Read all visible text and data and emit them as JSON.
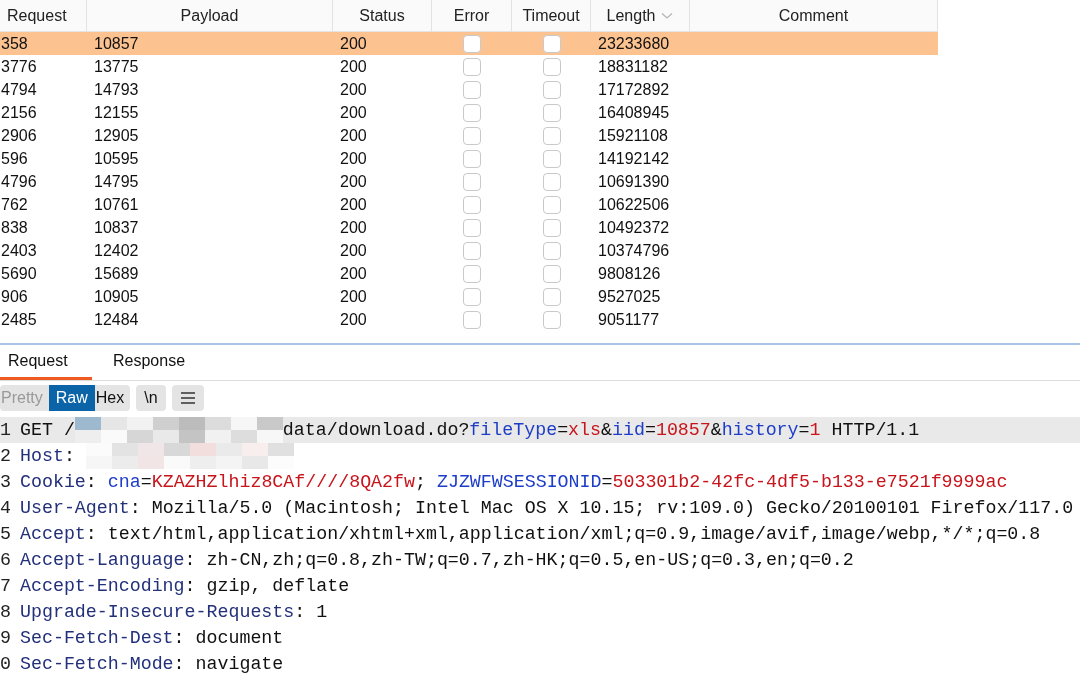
{
  "table": {
    "columns": [
      {
        "label": "Request",
        "sorted": false
      },
      {
        "label": "Payload",
        "sorted": false
      },
      {
        "label": "Status",
        "sorted": false
      },
      {
        "label": "Error",
        "sorted": false
      },
      {
        "label": "Timeout",
        "sorted": false
      },
      {
        "label": "Length",
        "sorted": true
      },
      {
        "label": "Comment",
        "sorted": false
      }
    ],
    "rows": [
      {
        "request": "358",
        "payload": "10857",
        "status": "200",
        "error": false,
        "timeout": false,
        "length": "23233680",
        "selected": true
      },
      {
        "request": "3776",
        "payload": "13775",
        "status": "200",
        "error": false,
        "timeout": false,
        "length": "18831182",
        "selected": false
      },
      {
        "request": "4794",
        "payload": "14793",
        "status": "200",
        "error": false,
        "timeout": false,
        "length": "17172892",
        "selected": false
      },
      {
        "request": "2156",
        "payload": "12155",
        "status": "200",
        "error": false,
        "timeout": false,
        "length": "16408945",
        "selected": false
      },
      {
        "request": "2906",
        "payload": "12905",
        "status": "200",
        "error": false,
        "timeout": false,
        "length": "15921108",
        "selected": false
      },
      {
        "request": "596",
        "payload": "10595",
        "status": "200",
        "error": false,
        "timeout": false,
        "length": "14192142",
        "selected": false
      },
      {
        "request": "4796",
        "payload": "14795",
        "status": "200",
        "error": false,
        "timeout": false,
        "length": "10691390",
        "selected": false
      },
      {
        "request": "762",
        "payload": "10761",
        "status": "200",
        "error": false,
        "timeout": false,
        "length": "10622506",
        "selected": false
      },
      {
        "request": "838",
        "payload": "10837",
        "status": "200",
        "error": false,
        "timeout": false,
        "length": "10492372",
        "selected": false
      },
      {
        "request": "2403",
        "payload": "12402",
        "status": "200",
        "error": false,
        "timeout": false,
        "length": "10374796",
        "selected": false
      },
      {
        "request": "5690",
        "payload": "15689",
        "status": "200",
        "error": false,
        "timeout": false,
        "length": "9808126",
        "selected": false
      },
      {
        "request": "906",
        "payload": "10905",
        "status": "200",
        "error": false,
        "timeout": false,
        "length": "9527025",
        "selected": false
      },
      {
        "request": "2485",
        "payload": "12484",
        "status": "200",
        "error": false,
        "timeout": false,
        "length": "9051177",
        "selected": false
      }
    ]
  },
  "tabs": [
    {
      "label": "Request",
      "selected": true
    },
    {
      "label": "Response",
      "selected": false
    }
  ],
  "view_modes": [
    {
      "label": "Pretty",
      "selected": false
    },
    {
      "label": "Raw",
      "selected": true
    },
    {
      "label": "Hex",
      "selected": false
    }
  ],
  "toolbar_buttons": [
    "\\n"
  ],
  "editor": {
    "lines": [
      {
        "number": "1",
        "highlighted": true,
        "segments": [
          {
            "kind": "text",
            "text": "GET /"
          },
          {
            "kind": "redacted"
          },
          {
            "kind": "text",
            "text": "data/download.do?"
          },
          {
            "kind": "param",
            "text": "fileType"
          },
          {
            "kind": "text",
            "text": "="
          },
          {
            "kind": "value",
            "text": "xls"
          },
          {
            "kind": "text",
            "text": "&"
          },
          {
            "kind": "param",
            "text": "iid"
          },
          {
            "kind": "text",
            "text": "="
          },
          {
            "kind": "value",
            "text": "10857"
          },
          {
            "kind": "text",
            "text": "&"
          },
          {
            "kind": "param",
            "text": "history"
          },
          {
            "kind": "text",
            "text": "="
          },
          {
            "kind": "value",
            "text": "1"
          },
          {
            "kind": "text",
            "text": " HTTP/1.1"
          }
        ]
      },
      {
        "number": "2",
        "highlighted": false,
        "segments": [
          {
            "kind": "header",
            "text": "Host"
          },
          {
            "kind": "text",
            "text": ": "
          },
          {
            "kind": "redacted"
          }
        ]
      },
      {
        "number": "3",
        "highlighted": false,
        "segments": [
          {
            "kind": "header",
            "text": "Cookie"
          },
          {
            "kind": "text",
            "text": ": "
          },
          {
            "kind": "param",
            "text": "cna"
          },
          {
            "kind": "text",
            "text": "="
          },
          {
            "kind": "value",
            "text": "KZAZHZlhiz8CAf////8QA2fw"
          },
          {
            "kind": "text",
            "text": "; "
          },
          {
            "kind": "param",
            "text": "ZJZWFWSESSIONID"
          },
          {
            "kind": "text",
            "text": "="
          },
          {
            "kind": "value",
            "text": "503301b2-42fc-4df5-b133-e7521f9999ac"
          }
        ]
      },
      {
        "number": "4",
        "highlighted": false,
        "segments": [
          {
            "kind": "header",
            "text": "User-Agent"
          },
          {
            "kind": "text",
            "text": ": Mozilla/5.0 (Macintosh; Intel Mac OS X 10.15; rv:109.0) Gecko/20100101 Firefox/117.0"
          }
        ]
      },
      {
        "number": "5",
        "highlighted": false,
        "segments": [
          {
            "kind": "header",
            "text": "Accept"
          },
          {
            "kind": "text",
            "text": ": text/html,application/xhtml+xml,application/xml;q=0.9,image/avif,image/webp,*/*;q=0.8"
          }
        ]
      },
      {
        "number": "6",
        "highlighted": false,
        "segments": [
          {
            "kind": "header",
            "text": "Accept-Language"
          },
          {
            "kind": "text",
            "text": ": zh-CN,zh;q=0.8,zh-TW;q=0.7,zh-HK;q=0.5,en-US;q=0.3,en;q=0.2"
          }
        ]
      },
      {
        "number": "7",
        "highlighted": false,
        "segments": [
          {
            "kind": "header",
            "text": "Accept-Encoding"
          },
          {
            "kind": "text",
            "text": ": gzip, deflate"
          }
        ]
      },
      {
        "number": "8",
        "highlighted": false,
        "segments": [
          {
            "kind": "header",
            "text": "Upgrade-Insecure-Requests"
          },
          {
            "kind": "text",
            "text": ": 1"
          }
        ]
      },
      {
        "number": "9",
        "highlighted": false,
        "segments": [
          {
            "kind": "header",
            "text": "Sec-Fetch-Dest"
          },
          {
            "kind": "text",
            "text": ": document"
          }
        ]
      },
      {
        "number": "0",
        "highlighted": false,
        "segments": [
          {
            "kind": "header",
            "text": "Sec-Fetch-Mode"
          },
          {
            "kind": "text",
            "text": ": navigate"
          }
        ]
      }
    ]
  }
}
